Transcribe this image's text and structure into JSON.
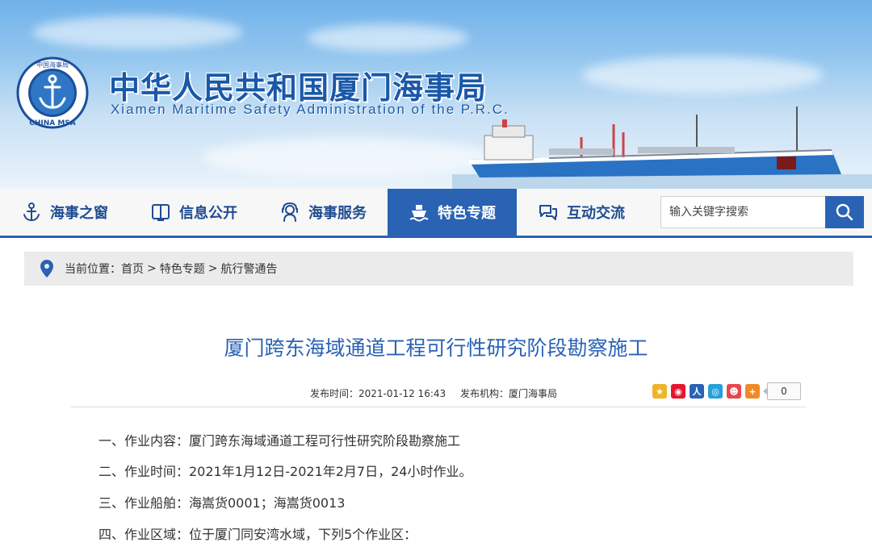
{
  "header": {
    "title_cn": "中华人民共和国厦门海事局",
    "title_en": "Xiamen Maritime Safety Administration of the P.R.C.",
    "logo_text_top": "中国海事局",
    "logo_text_bottom": "CHINA MSA"
  },
  "nav": {
    "items": [
      {
        "label": "海事之窗",
        "icon": "anchor-icon"
      },
      {
        "label": "信息公开",
        "icon": "book-icon"
      },
      {
        "label": "海事服务",
        "icon": "service-icon"
      },
      {
        "label": "特色专题",
        "icon": "ship-icon"
      },
      {
        "label": "互动交流",
        "icon": "chat-icon"
      }
    ],
    "active_index": 3,
    "search_placeholder": "输入关键字搜索"
  },
  "breadcrumb": {
    "prefix": "当前位置：",
    "items": [
      "首页",
      "特色专题",
      "航行警通告"
    ],
    "separator": ">"
  },
  "article": {
    "title": "厦门跨东海域通道工程可行性研究阶段勘察施工",
    "meta_time": "发布时间：2021-01-12 16:43",
    "meta_org": "发布机构：厦门海事局",
    "share_count": "0",
    "paragraphs": [
      "一、作业内容：厦门跨东海域通道工程可行性研究阶段勘察施工",
      "二、作业时间：2021年1月12日-2021年2月7日，24小时作业。",
      "三、作业船舶：海嵩货0001；海嵩货0013",
      "四、作业区域：位于厦门同安湾水域，下列5个作业区："
    ]
  },
  "colors": {
    "brand_blue": "#2a62b4",
    "title_blue": "#1a58a8",
    "nav_bg": "#f7f7f7",
    "crumb_bg": "#ebebeb"
  }
}
